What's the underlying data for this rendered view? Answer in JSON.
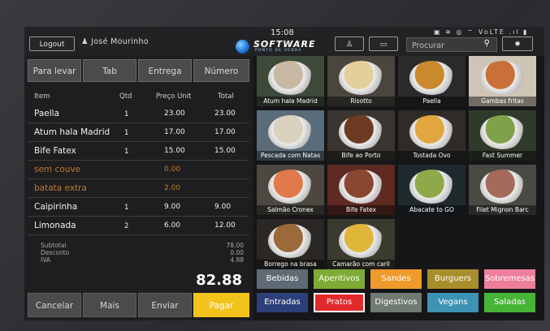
{
  "topbar": {
    "logout_label": "Logout",
    "user_name": "José Mourinho",
    "clock": "15:08",
    "brand": "SOFTWARE",
    "brand_sub": "PONTO DE VENDA",
    "status_icons": "▣ ≋ ◎ ⌔ VoLTE .ıl ▮",
    "search_placeholder": "Procurar"
  },
  "order_tabs": [
    "Para levar",
    "Tab",
    "Entrega",
    "Número"
  ],
  "order_table": {
    "headers": {
      "item": "Item",
      "qty": "Qtd",
      "price": "Preço Unit",
      "total": "Total"
    },
    "rows": [
      {
        "item": "Paella",
        "qty": "1",
        "price": "23.00",
        "total": "23.00",
        "modifier": false
      },
      {
        "item": "Atum hala Madrid",
        "qty": "1",
        "price": "17.00",
        "total": "17.00",
        "modifier": false
      },
      {
        "item": "Bife Fatex",
        "qty": "1",
        "price": "15.00",
        "total": "15.00",
        "modifier": false
      },
      {
        "item": "sem couve",
        "qty": "",
        "price": "0.00",
        "total": "",
        "modifier": true
      },
      {
        "item": "batata extra",
        "qty": "",
        "price": "2.00",
        "total": "",
        "modifier": true
      },
      {
        "item": "Caipirinha",
        "qty": "1",
        "price": "9.00",
        "total": "9.00",
        "modifier": false
      },
      {
        "item": "Limonada",
        "qty": "2",
        "price": "6.00",
        "total": "12.00",
        "modifier": false
      }
    ]
  },
  "totals": {
    "subtotal_label": "Subtotal",
    "subtotal": "78.00",
    "desconto_label": "Desconto",
    "desconto": "0.00",
    "iva_label": "IVA",
    "iva": "4.88",
    "grand_total": "82.88"
  },
  "actions": {
    "cancel": "Cancelar",
    "more": "Mais",
    "send": "Enviar",
    "pay": "Pagar"
  },
  "products": [
    {
      "name": "Atum hala Madrid",
      "bg": "#3d4a3a",
      "plate": "#c9b9a4"
    },
    {
      "name": "Risotto",
      "bg": "#4a463e",
      "plate": "#e2cf9a"
    },
    {
      "name": "Paella",
      "bg": "#2a2a2a",
      "plate": "#c9892c"
    },
    {
      "name": "Gambas fritas",
      "bg": "#cfc5b6",
      "plate": "#c9703a"
    },
    {
      "name": "Pescada com Natas",
      "bg": "#5a6b7a",
      "plate": "#d9d0bd"
    },
    {
      "name": "Bife ao Porto",
      "bg": "#3a3530",
      "plate": "#6d3a24"
    },
    {
      "name": "Tostada Ovo",
      "bg": "#2e2b28",
      "plate": "#e2a640"
    },
    {
      "name": "Fast Summer",
      "bg": "#303a2b",
      "plate": "#7fa14a"
    },
    {
      "name": "Salmão Cronex",
      "bg": "#4c4840",
      "plate": "#e07a4a"
    },
    {
      "name": "Bife Fatex",
      "bg": "#5e2a22",
      "plate": "#8a4630"
    },
    {
      "name": "Abacate to GO",
      "bg": "#1f2a2e",
      "plate": "#8fa84a"
    },
    {
      "name": "Filet Mignon Barc",
      "bg": "#4a4a44",
      "plate": "#a46a5a"
    },
    {
      "name": "Borrego na brasa",
      "bg": "#2b2724",
      "plate": "#9a6a3a"
    },
    {
      "name": "Camarão com caril",
      "bg": "#3a3a2e",
      "plate": "#e0b63a"
    }
  ],
  "categories": [
    {
      "label": "Bebidas",
      "color": "#5e6a74",
      "selected": false
    },
    {
      "label": "Aperitivos",
      "color": "#7dab35",
      "selected": false
    },
    {
      "label": "Sandes",
      "color": "#ee9a2d",
      "selected": false
    },
    {
      "label": "Burguers",
      "color": "#a88f2c",
      "selected": false
    },
    {
      "label": "Sobremesas",
      "color": "#ee7f9c",
      "selected": false
    },
    {
      "label": "Entradas",
      "color": "#2d3f78",
      "selected": false
    },
    {
      "label": "Pratos",
      "color": "#e22a2a",
      "selected": true
    },
    {
      "label": "Digestivos",
      "color": "#6f7a70",
      "selected": false
    },
    {
      "label": "Vegans",
      "color": "#3c93b4",
      "selected": false
    },
    {
      "label": "Saladas",
      "color": "#46b436",
      "selected": false
    }
  ]
}
